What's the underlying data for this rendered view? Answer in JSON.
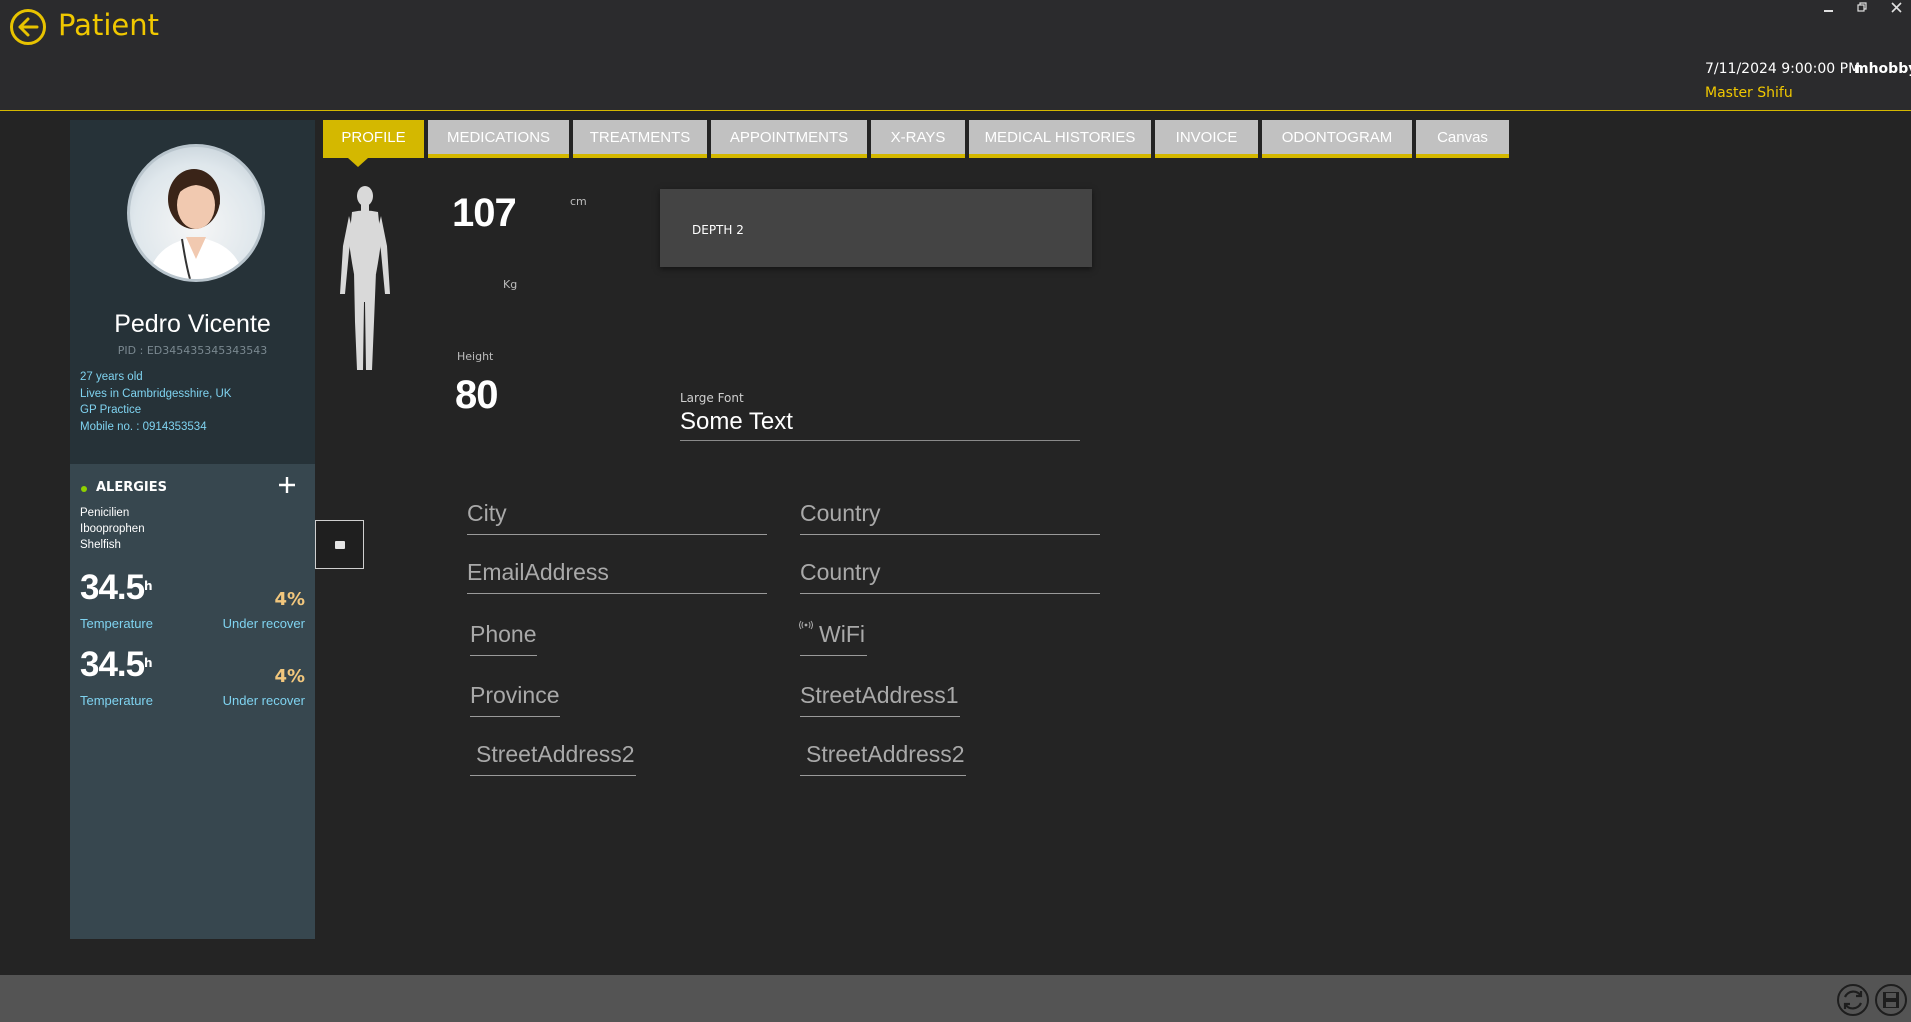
{
  "header": {
    "title": "Patient",
    "datetime": "7/11/2024 9:00:00 PM",
    "username": "mhobby",
    "role": "Master Shifu",
    "window_controls": [
      "minimize-icon",
      "restore-icon",
      "close-icon"
    ]
  },
  "patient": {
    "name": "Pedro Vicente",
    "pid": "PID : ED345435345343543",
    "info": [
      "27 years old",
      "Lives in Cambridgesshire, UK",
      "GP Practice",
      "Mobile no. : 0914353534"
    ]
  },
  "allergies": {
    "title": "ALERGIES",
    "items": [
      "Penicilien",
      "Ibooprophen",
      "Shelfish"
    ]
  },
  "stats": [
    {
      "value": "34.5",
      "unit": "h",
      "percent": "4%",
      "label": "Temperature",
      "status": "Under recover"
    },
    {
      "value": "34.5",
      "unit": "h",
      "percent": "4%",
      "label": "Temperature",
      "status": "Under recover"
    }
  ],
  "tabs": [
    "PROFILE",
    "MEDICATIONS",
    "TREATMENTS",
    "APPOINTMENTS",
    "X-RAYS",
    "MEDICAL HISTORIES",
    "INVOICE",
    "ODONTOGRAM",
    "Canvas"
  ],
  "profile": {
    "weight_value": "107",
    "cm_unit": "cm",
    "kg_unit": "Kg",
    "height_label": "Height",
    "height_value": "80",
    "depth_label": "DEPTH 2",
    "large_font_label": "Large Font",
    "large_font_value": "Some Text"
  },
  "fields": {
    "city": "City",
    "country1": "Country",
    "email": "EmailAddress",
    "country2": "Country",
    "phone": "Phone",
    "wifi": "WiFi",
    "province": "Province",
    "street1": "StreetAddress1",
    "street2_left": "StreetAddress2",
    "street2_right": "StreetAddress2"
  },
  "colors": {
    "accent": "#d4b800",
    "info_text": "#7fd3f0",
    "percent": "#f2c77d"
  }
}
